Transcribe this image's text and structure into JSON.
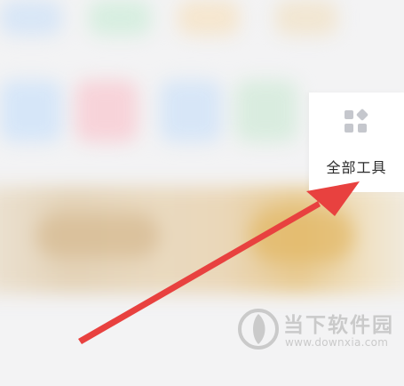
{
  "tools_card": {
    "label": "全部工具",
    "icon": "grid-apps-icon"
  },
  "watermark": {
    "name": "当下软件园",
    "url": "www.downxia.com",
    "icon": "downxia-logo-icon"
  },
  "annotation": {
    "icon": "red-pointer-arrow-icon",
    "color": "#e8413f"
  }
}
